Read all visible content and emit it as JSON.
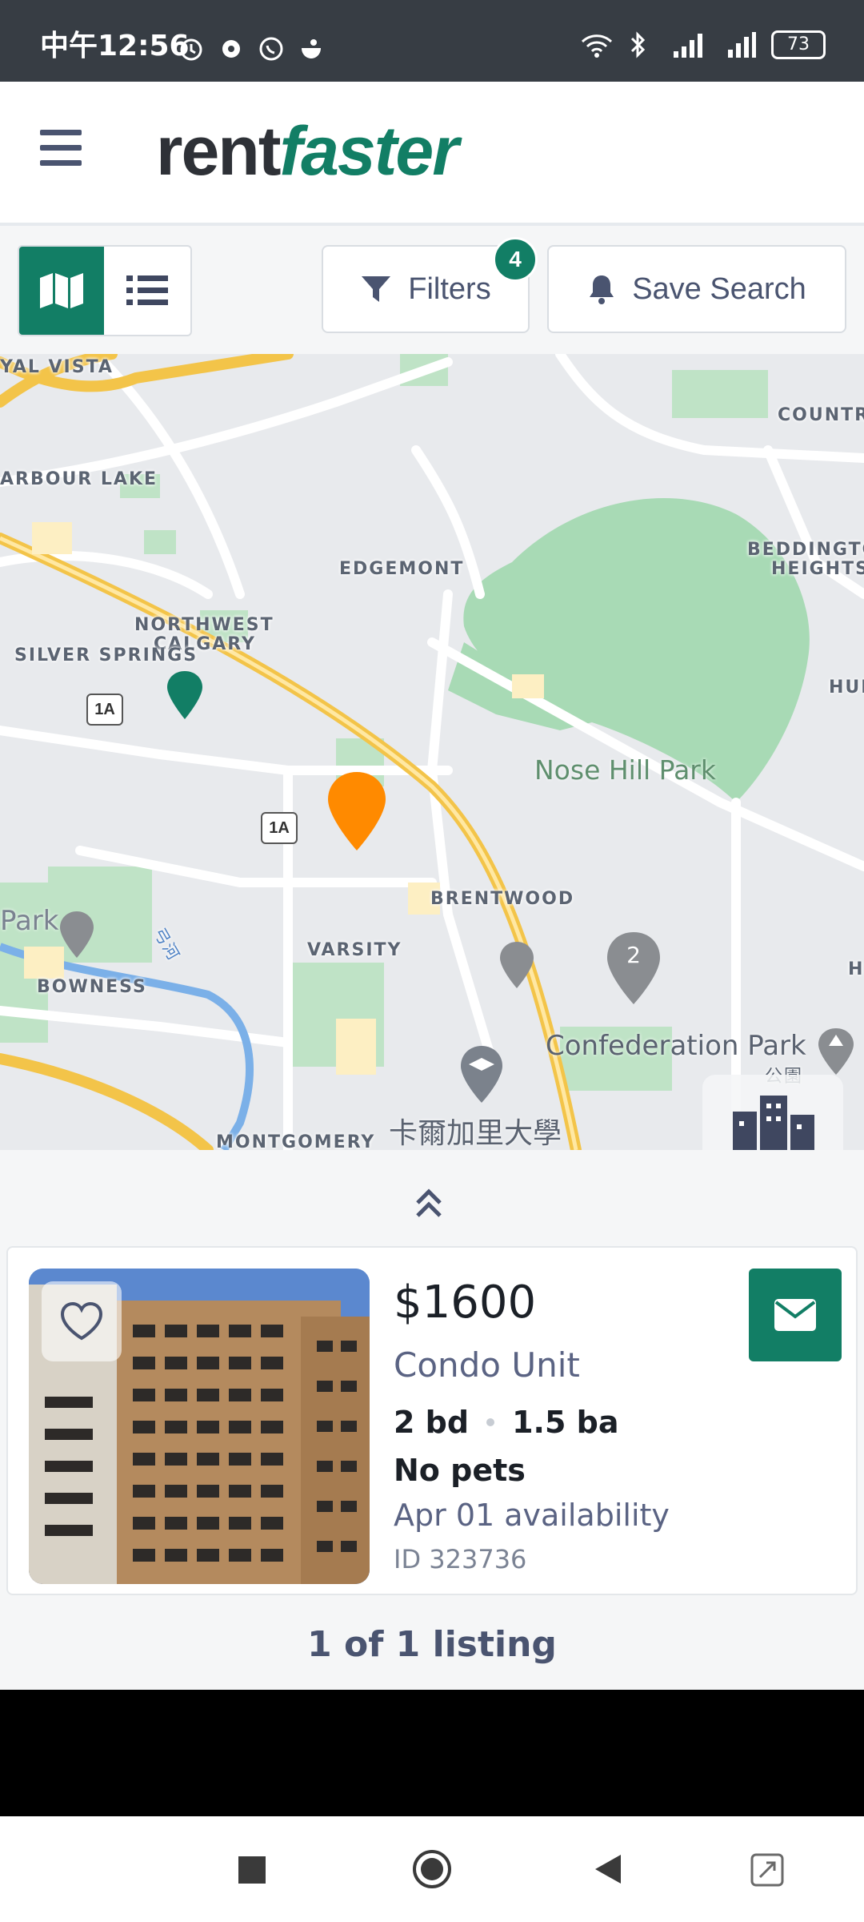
{
  "status_bar": {
    "time": "中午12:56",
    "battery": "73"
  },
  "header": {
    "logo_rent": "rent",
    "logo_faster": "faster"
  },
  "toolbar": {
    "filters_label": "Filters",
    "filters_count": "4",
    "save_search_label": "Save Search"
  },
  "map": {
    "labels": {
      "royal_vista": "YAL VISTA",
      "harbour_lake": "ARBOUR LAKE",
      "edgemont": "EDGEMONT",
      "northwest_calgary_1": "NORTHWEST",
      "northwest_calgary_2": "CALGARY",
      "silver_springs": "SILVER SPRINGS",
      "brentwood": "BRENTWOOD",
      "varsity": "VARSITY",
      "bowness": "BOWNESS",
      "montgomery": "MONTGOMERY",
      "country": "COUNTR",
      "beddington_1": "BEDDINGTO",
      "beddington_2": "HEIGHTS",
      "hun": "HUN",
      "h": "H",
      "park_left": "Park",
      "nose_hill": "Nose Hill Park",
      "confederation": "Confederation Park",
      "gongyuan": "公園",
      "university": "卡爾加里大學",
      "river": "弓河",
      "hwy_1a_a": "1A",
      "hwy_1a_b": "1A",
      "cluster_count": "2"
    }
  },
  "listing": {
    "price": "$1600",
    "type": "Condo Unit",
    "beds": "2 bd",
    "baths": "1.5 ba",
    "pets": "No pets",
    "availability": "Apr 01 availability",
    "id": "ID 323736"
  },
  "results": {
    "count_text": "1 of 1 listing"
  },
  "colors": {
    "brand": "#127e65",
    "selected_pin": "#ff8a00",
    "grey_pin": "#8a8d91",
    "park_green": "#a8dab5"
  }
}
